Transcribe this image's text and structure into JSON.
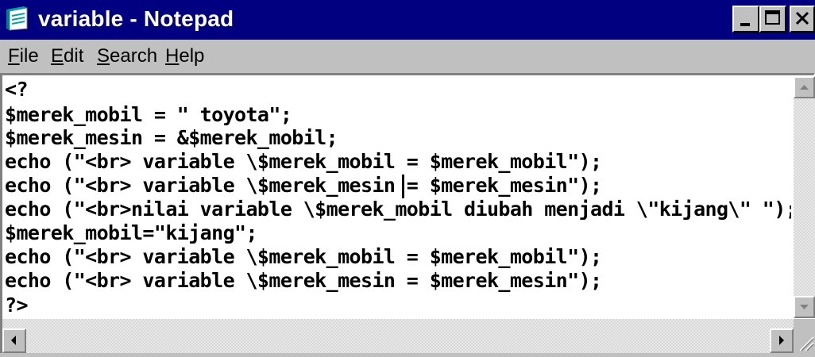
{
  "window": {
    "title": "variable - Notepad",
    "app_icon": "notepad-icon",
    "controls": [
      "minimize-icon",
      "maximize-icon",
      "close-icon"
    ]
  },
  "menu": {
    "items": [
      {
        "label": "File",
        "mnemonic": "F"
      },
      {
        "label": "Edit",
        "mnemonic": "E"
      },
      {
        "label": "Search",
        "mnemonic": "S"
      },
      {
        "label": "Help",
        "mnemonic": "H"
      }
    ]
  },
  "editor": {
    "lines": [
      "<?",
      "$merek_mobil = \" toyota\";",
      "$merek_mesin = &$merek_mobil;",
      "echo (\"<br> variable \\$merek_mobil = $merek_mobil\");",
      "echo (\"<br> variable \\$merek_mesin = $merek_mesin\");",
      "echo (\"<br>nilai variable \\$merek_mobil diubah menjadi \\\"kijang\\\" \");",
      "$merek_mobil=\"kijang\";",
      "echo (\"<br> variable \\$merek_mobil = $merek_mobil\");",
      "echo (\"<br> variable \\$merek_mesin = $merek_mesin\");",
      "?>"
    ]
  },
  "scrollbars": {
    "vertical_icons": [
      "arrow-up-icon",
      "arrow-down-icon"
    ],
    "horizontal_icons": [
      "arrow-left-icon",
      "arrow-right-icon"
    ]
  },
  "colors": {
    "titlebar": "#000080",
    "chrome": "#c0c0c0",
    "editor_bg": "#ffffff",
    "text": "#000000"
  }
}
